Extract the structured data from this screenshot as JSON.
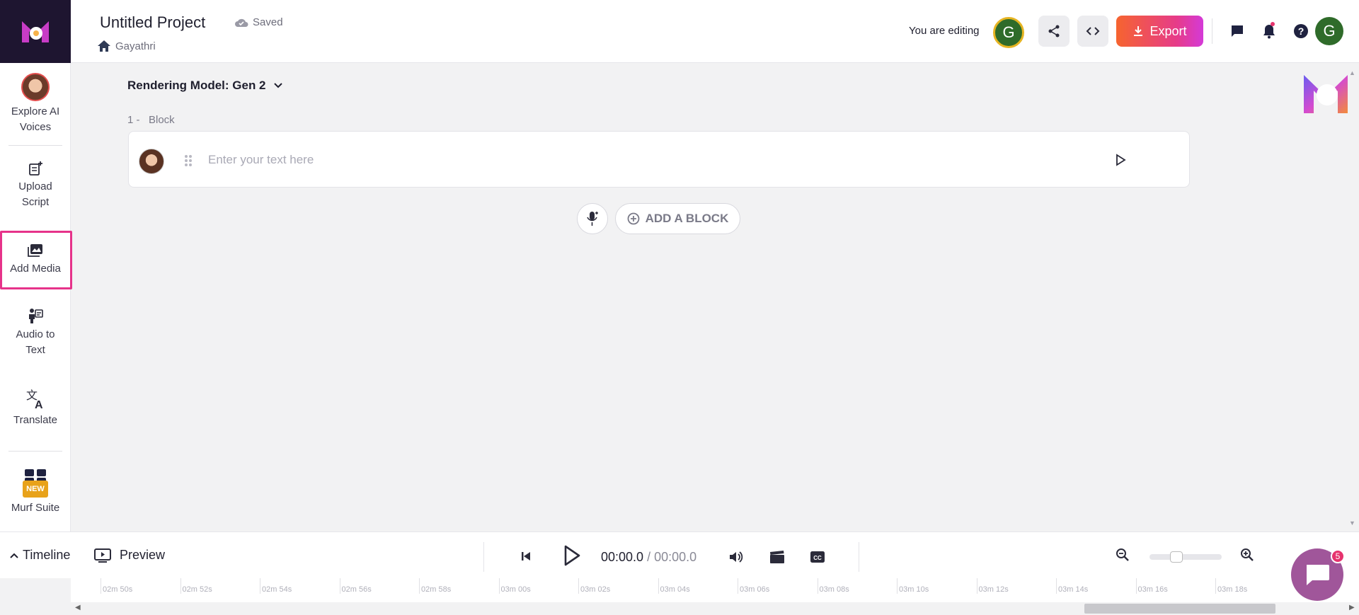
{
  "header": {
    "project_title": "Untitled Project",
    "saved_label": "Saved",
    "breadcrumb_home": "Gayathri",
    "editing_label": "You are editing",
    "editor_avatar_initial": "G",
    "export_label": "Export",
    "user_avatar_initial": "G"
  },
  "sidebar": {
    "items": [
      {
        "label_line1": "Explore AI",
        "label_line2": "Voices"
      },
      {
        "label_line1": "Upload",
        "label_line2": "Script"
      },
      {
        "label_line1": "Add Media",
        "label_line2": ""
      },
      {
        "label_line1": "Audio to",
        "label_line2": "Text"
      },
      {
        "label_line1": "Translate",
        "label_line2": ""
      },
      {
        "label_line1": "Murf Suite",
        "label_line2": "",
        "badge": "NEW"
      }
    ]
  },
  "editor": {
    "rendering_model_label": "Rendering Model: Gen 2",
    "block_label": "1 -   Block",
    "text_placeholder": "Enter your text here",
    "add_block_label": "ADD A BLOCK"
  },
  "bottom_bar": {
    "timeline_label": "Timeline",
    "preview_label": "Preview",
    "current_time": "00:00.0",
    "time_separator": " / ",
    "total_time": "00:00.0",
    "zoom_level_fraction": 0.35
  },
  "ruler": {
    "labels": [
      "02m 50s",
      "02m 52s",
      "02m 54s",
      "02m 56s",
      "02m 58s",
      "03m 00s",
      "03m 02s",
      "03m 04s",
      "03m 06s",
      "03m 08s",
      "03m 10s",
      "03m 12s",
      "03m 14s",
      "03m 16s",
      "03m 18s"
    ]
  },
  "chat": {
    "badge_count": "5"
  },
  "colors": {
    "accent_pink": "#e6338a",
    "export_gradient_start": "#f6642f",
    "export_gradient_end": "#d43ad8",
    "avatar_green": "#2f6b2a"
  }
}
